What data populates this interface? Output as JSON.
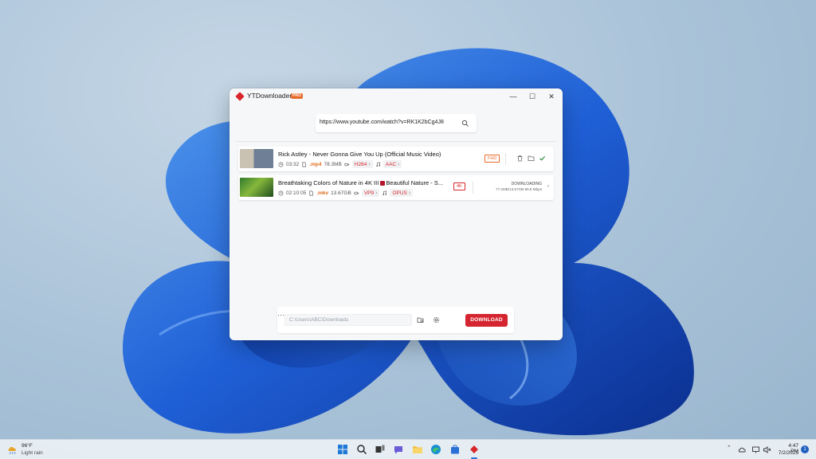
{
  "window": {
    "title": "YTDownloader",
    "badge": "PRO",
    "controls": {
      "minimize": "—",
      "maximize": "☐",
      "close": "✕"
    }
  },
  "url_bar": {
    "value": "https://www.youtube.com/watch?v=RK1K2bCg4J8",
    "icon": "search-icon"
  },
  "downloads": [
    {
      "title": "Rick Astley - Never Gonna Give You Up (Official Music Video)",
      "duration": "03:32",
      "ext": ".mp4",
      "size": "78.3MB",
      "video_codec": "H264",
      "audio_codec": "AAC",
      "quality": "FHD",
      "status": "completed"
    },
    {
      "title": "Breathtaking Colors of Nature in 4K III",
      "channel": "Beautiful Nature - S...",
      "duration": "02:10:05",
      "ext": ".mkv",
      "size": "13.67GB",
      "video_codec": "VP9",
      "audio_codec": "OPUS",
      "quality": "4K",
      "status_text": "DOWNLOADING",
      "progress_text": "77.2MB/13.67GB 85.8 Mbps",
      "more": "›"
    }
  ],
  "bottom": {
    "path_placeholder": "C:\\Users\\ABC\\Downloads",
    "more": "···",
    "download_label": "DOWNLOAD"
  },
  "taskbar": {
    "weather_temp": "96°F",
    "weather_desc": "Light rain",
    "time": "4:47 PM",
    "date": "7/2/2023",
    "notification_count": "1"
  },
  "colors": {
    "accent": "#d42530",
    "orange": "#e86a2a",
    "taskbar": "#e8eef4"
  }
}
